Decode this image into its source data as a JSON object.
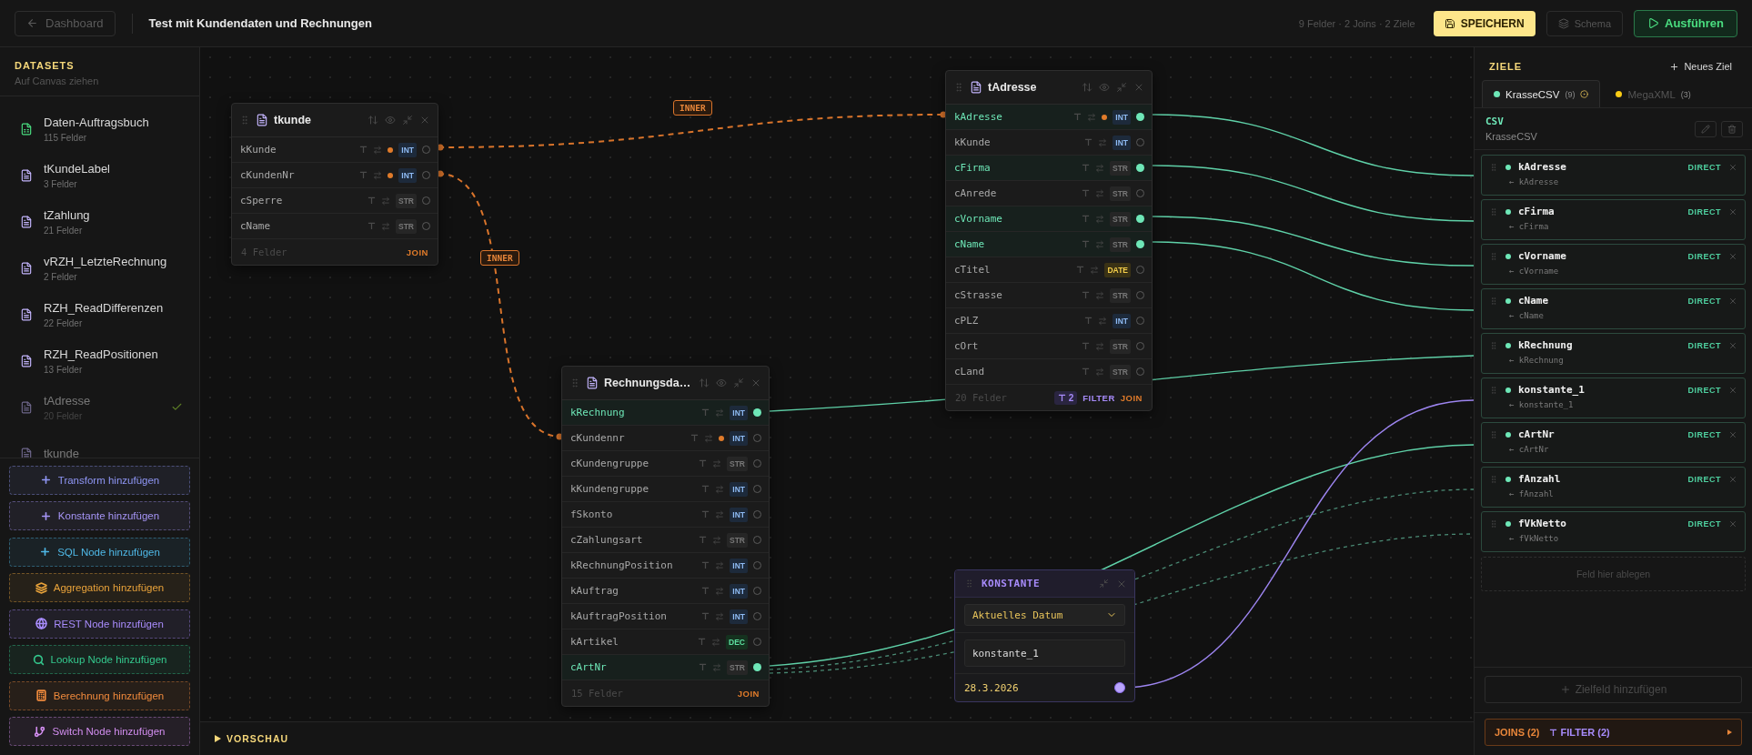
{
  "header": {
    "back": "Dashboard",
    "title": "Test mit Kundendaten und Rechnungen",
    "stats": "9 Felder · 2 Joins · 2 Ziele",
    "save": "SPEICHERN",
    "schema": "Schema",
    "run": "Ausführen"
  },
  "sidebar": {
    "title": "DATASETS",
    "subtitle": "Auf Canvas ziehen",
    "datasets": [
      {
        "name": "Daten-Auftragsbuch",
        "fields": "115 Felder",
        "kind": "sheet",
        "on_canvas": false
      },
      {
        "name": "tKundeLabel",
        "fields": "3 Felder",
        "kind": "table",
        "on_canvas": false
      },
      {
        "name": "tZahlung",
        "fields": "21 Felder",
        "kind": "table",
        "on_canvas": false
      },
      {
        "name": "vRZH_LetzteRechnung",
        "fields": "2 Felder",
        "kind": "table",
        "on_canvas": false
      },
      {
        "name": "RZH_ReadDifferenzen",
        "fields": "22 Felder",
        "kind": "table",
        "on_canvas": false
      },
      {
        "name": "RZH_ReadPositionen",
        "fields": "13 Felder",
        "kind": "table",
        "on_canvas": false
      },
      {
        "name": "tAdresse",
        "fields": "20 Felder",
        "kind": "table",
        "on_canvas": true
      },
      {
        "name": "tkunde",
        "kind": "table",
        "on_canvas": true
      }
    ],
    "actions": [
      {
        "label": "Transform hinzufügen",
        "kind": "transform",
        "color": "#8f96f5"
      },
      {
        "label": "Konstante hinzufügen",
        "kind": "constant",
        "color": "#a594f5"
      },
      {
        "label": "SQL Node hinzufügen",
        "kind": "sql",
        "color": "#4fb8e6"
      },
      {
        "label": "Aggregation hinzufügen",
        "kind": "aggregation",
        "color": "#e8a23a"
      },
      {
        "label": "REST Node hinzufügen",
        "kind": "rest",
        "color": "#a78bfa"
      },
      {
        "label": "Lookup Node hinzufügen",
        "kind": "lookup",
        "color": "#34c98e"
      },
      {
        "label": "Berechnung hinzufügen",
        "kind": "calc",
        "color": "#f08a3c"
      },
      {
        "label": "Switch Node hinzufügen",
        "kind": "switch",
        "color": "#d38ef0"
      }
    ]
  },
  "joins": [
    {
      "type": "INNER"
    },
    {
      "type": "INNER"
    }
  ],
  "nodes": [
    {
      "title": "tkunde",
      "footer": "4 Felder",
      "join": "JOIN",
      "fields": [
        {
          "name": "kKunde",
          "type": "INT",
          "key": true,
          "connected": false
        },
        {
          "name": "cKundenNr",
          "type": "INT",
          "key": true,
          "connected": false
        },
        {
          "name": "cSperre",
          "type": "STR",
          "key": false,
          "connected": false
        },
        {
          "name": "cName",
          "type": "STR",
          "key": false,
          "connected": false
        }
      ]
    },
    {
      "title": "tAdresse",
      "footer": "20 Felder",
      "filter_count": "2",
      "filter": "FILTER",
      "join": "JOIN",
      "fields": [
        {
          "name": "kAdresse",
          "type": "INT",
          "key": true,
          "connected": true
        },
        {
          "name": "kKunde",
          "type": "INT",
          "key": false,
          "connected": false
        },
        {
          "name": "cFirma",
          "type": "STR",
          "key": false,
          "connected": true
        },
        {
          "name": "cAnrede",
          "type": "STR",
          "key": false,
          "connected": false
        },
        {
          "name": "cVorname",
          "type": "STR",
          "key": false,
          "connected": true
        },
        {
          "name": "cName",
          "type": "STR",
          "key": false,
          "connected": true
        },
        {
          "name": "cTitel",
          "type": "DATE",
          "key": false,
          "connected": false
        },
        {
          "name": "cStrasse",
          "type": "STR",
          "key": false,
          "connected": false
        },
        {
          "name": "cPLZ",
          "type": "INT",
          "key": false,
          "connected": false
        },
        {
          "name": "cOrt",
          "type": "STR",
          "key": false,
          "connected": false
        },
        {
          "name": "cLand",
          "type": "STR",
          "key": false,
          "connected": false
        }
      ]
    },
    {
      "title": "Rechnungsda…",
      "footer": "15 Felder",
      "join": "JOIN",
      "fields": [
        {
          "name": "kRechnung",
          "type": "INT",
          "key": false,
          "connected": true
        },
        {
          "name": "cKundennr",
          "type": "INT",
          "key": true,
          "connected": false
        },
        {
          "name": "cKundengruppe",
          "type": "STR",
          "key": false,
          "connected": false
        },
        {
          "name": "kKundengruppe",
          "type": "INT",
          "key": false,
          "connected": false
        },
        {
          "name": "fSkonto",
          "type": "INT",
          "key": false,
          "connected": false
        },
        {
          "name": "cZahlungsart",
          "type": "STR",
          "key": false,
          "connected": false
        },
        {
          "name": "kRechnungPosition",
          "type": "INT",
          "key": false,
          "connected": false
        },
        {
          "name": "kAuftrag",
          "type": "INT",
          "key": false,
          "connected": false
        },
        {
          "name": "kAuftragPosition",
          "type": "INT",
          "key": false,
          "connected": false
        },
        {
          "name": "kArtikel",
          "type": "DEC",
          "key": false,
          "connected": false
        },
        {
          "name": "cArtNr",
          "type": "STR",
          "key": false,
          "connected": true
        }
      ]
    }
  ],
  "constant": {
    "title": "KONSTANTE",
    "mode": "Aktuelles Datum",
    "name": "konstante_1",
    "value": "28.3.2026"
  },
  "preview": {
    "label": "VORSCHAU"
  },
  "targets": {
    "title": "ZIELE",
    "new": "Neues Ziel",
    "tabs": [
      {
        "name": "KrasseCSV",
        "count": "(9)",
        "color": "#6ee7b7",
        "selected": true
      },
      {
        "name": "MegaXML",
        "count": "(3)",
        "color": "#facc15",
        "selected": false
      }
    ],
    "format": "CSV",
    "name": "KrasseCSV",
    "fields": [
      {
        "name": "kAdresse",
        "source": "← kAdresse",
        "mapping": "DIRECT"
      },
      {
        "name": "cFirma",
        "source": "← cFirma",
        "mapping": "DIRECT"
      },
      {
        "name": "cVorname",
        "source": "← cVorname",
        "mapping": "DIRECT"
      },
      {
        "name": "cName",
        "source": "← cName",
        "mapping": "DIRECT"
      },
      {
        "name": "kRechnung",
        "source": "← kRechnung",
        "mapping": "DIRECT"
      },
      {
        "name": "konstante_1",
        "source": "← konstante_1",
        "mapping": "DIRECT"
      },
      {
        "name": "cArtNr",
        "source": "← cArtNr",
        "mapping": "DIRECT"
      },
      {
        "name": "fAnzahl",
        "source": "← fAnzahl",
        "mapping": "DIRECT"
      },
      {
        "name": "fVkNetto",
        "source": "← fVkNetto",
        "mapping": "DIRECT"
      }
    ],
    "drop": "Feld hier ablegen",
    "add": "Zielfeld hinzufügen",
    "joins": "JOINS (2)",
    "filters": "FILTER (2)"
  }
}
